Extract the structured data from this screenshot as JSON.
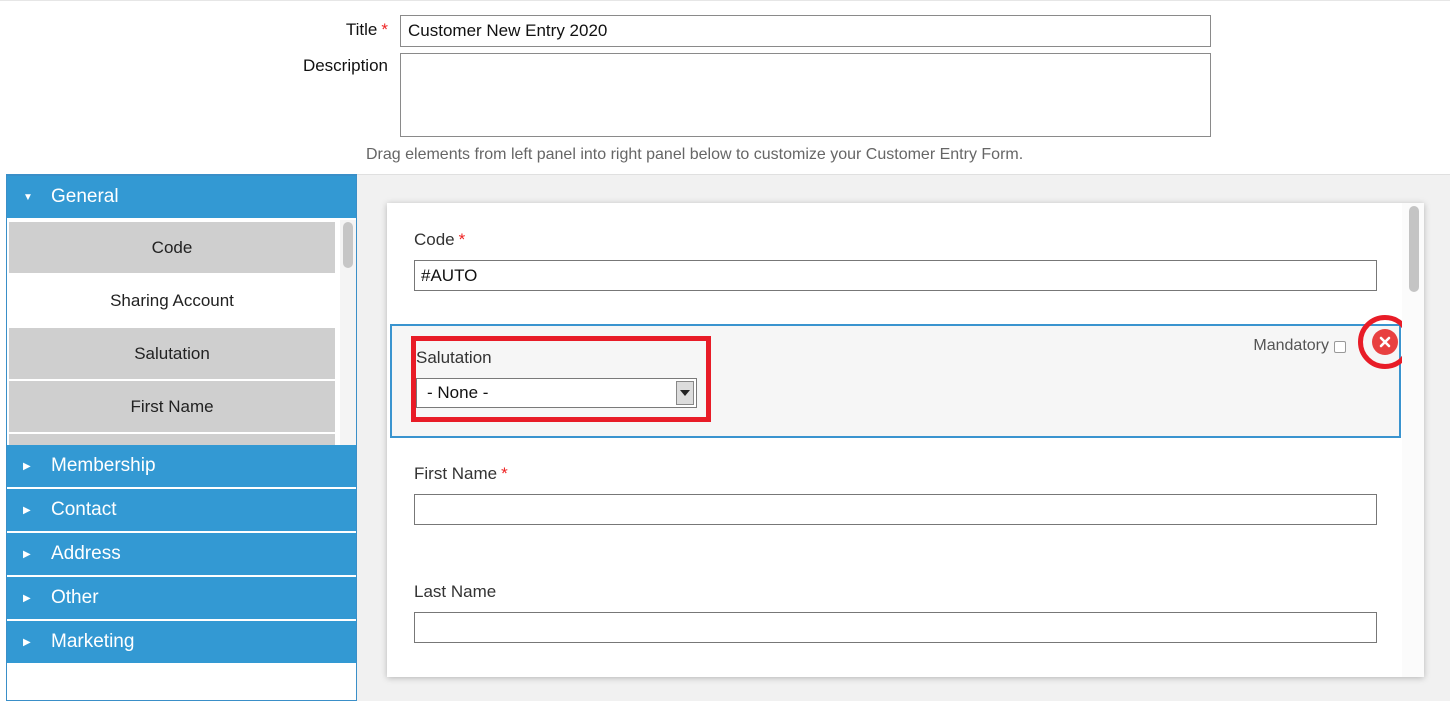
{
  "form": {
    "title_label": "Title",
    "required_mark": "*",
    "title_value": "Customer New Entry 2020",
    "description_label": "Description",
    "description_value": "",
    "hint": "Drag elements from left panel into right panel below to customize your Customer Entry Form."
  },
  "left_panel": {
    "general": {
      "label": "General",
      "icon": "caret-down-icon",
      "items": [
        "Code",
        "Sharing Account",
        "Salutation",
        "First Name"
      ]
    },
    "sections": [
      {
        "label": "Membership",
        "icon": "caret-right-icon"
      },
      {
        "label": "Contact",
        "icon": "caret-right-icon"
      },
      {
        "label": "Address",
        "icon": "caret-right-icon"
      },
      {
        "label": "Other",
        "icon": "caret-right-icon"
      },
      {
        "label": "Marketing",
        "icon": "caret-right-icon"
      }
    ]
  },
  "preview": {
    "code": {
      "label": "Code",
      "value": "#AUTO"
    },
    "salutation": {
      "label": "Salutation",
      "selected": "- None -",
      "mandatory_label": "Mandatory",
      "mandatory_checked": false
    },
    "first_name": {
      "label": "First Name",
      "value": ""
    },
    "last_name": {
      "label": "Last Name",
      "value": ""
    }
  },
  "colors": {
    "accent": "#3399d3",
    "highlight": "#e81c27",
    "required": "#e22222"
  }
}
